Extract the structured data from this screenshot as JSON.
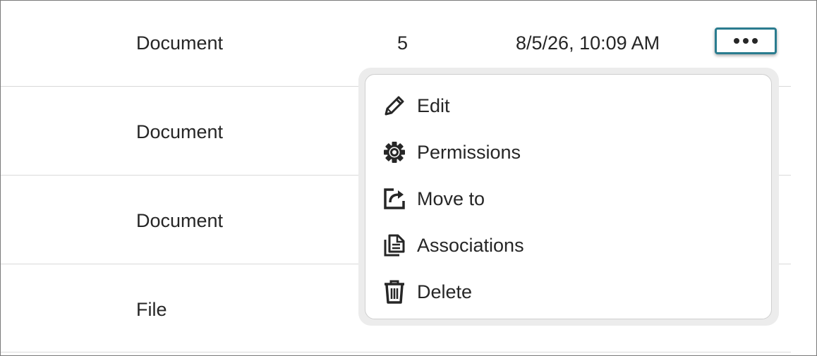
{
  "rows": [
    {
      "type": "Document",
      "count": "5",
      "date": "8/5/26, 10:09 AM"
    },
    {
      "type": "Document"
    },
    {
      "type": "Document"
    },
    {
      "type": "File"
    }
  ],
  "row_actions": {
    "more_icon": "ellipsis-icon"
  },
  "context_menu": {
    "items": [
      {
        "label": "Edit",
        "icon": "pencil-icon"
      },
      {
        "label": "Permissions",
        "icon": "gear-icon"
      },
      {
        "label": "Move to",
        "icon": "move-to-icon"
      },
      {
        "label": "Associations",
        "icon": "associations-icon"
      },
      {
        "label": "Delete",
        "icon": "trash-icon"
      }
    ]
  },
  "colors": {
    "focus_ring": "#2a7c8f",
    "text": "#262626",
    "divider": "#d9d9d9"
  }
}
